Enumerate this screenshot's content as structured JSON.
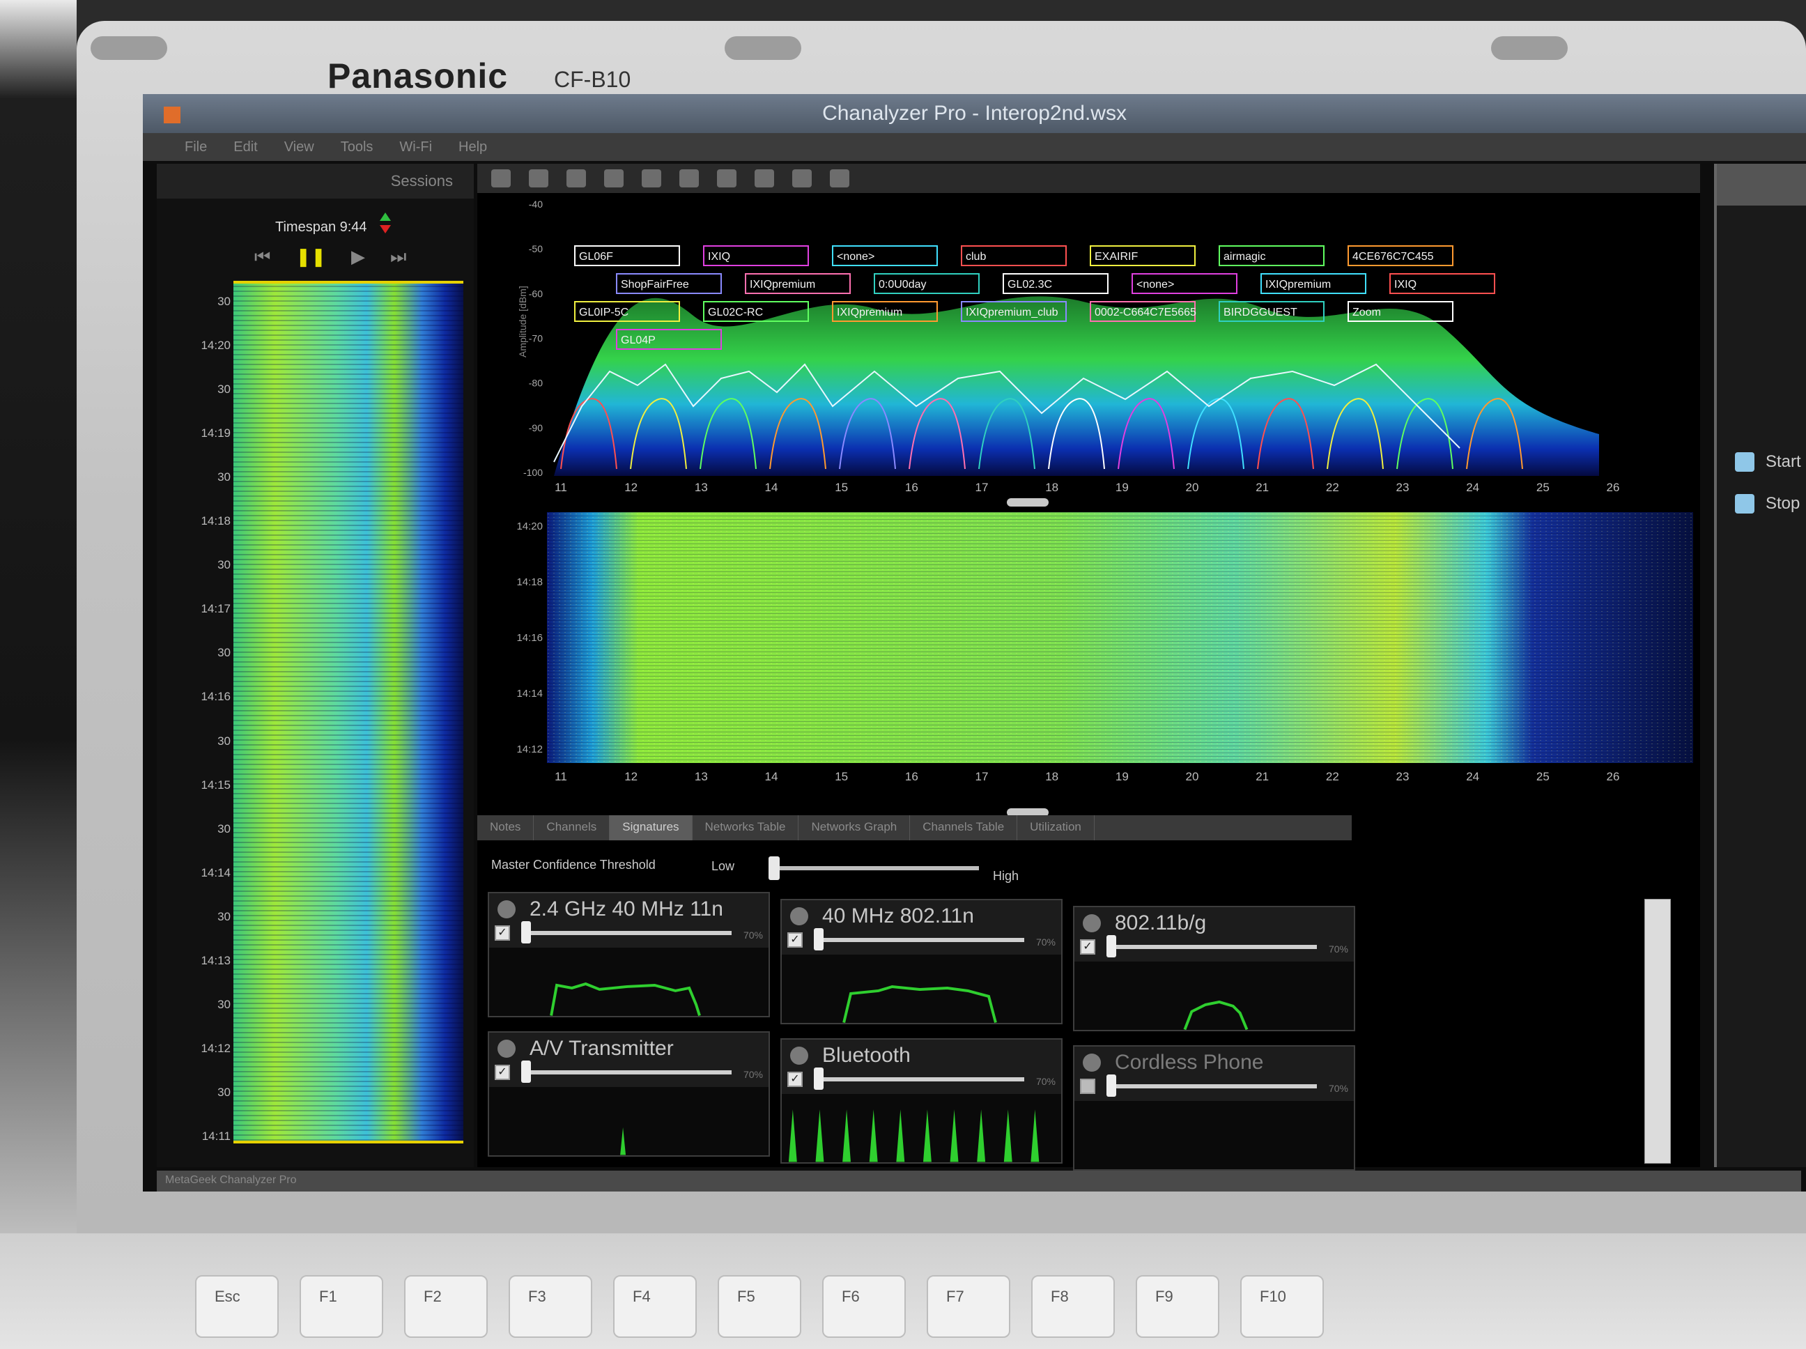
{
  "laptop": {
    "brand": "Panasonic",
    "model": "CF-B10",
    "keys": [
      "Esc",
      "F1",
      "F2",
      "F3",
      "F4",
      "F5",
      "F6",
      "F7",
      "F8",
      "F9",
      "F10"
    ]
  },
  "window": {
    "title": "Chanalyzer Pro - Interop2nd.wsx"
  },
  "menubar": {
    "items": [
      "File",
      "Edit",
      "View",
      "Tools",
      "Wi-Fi",
      "Help"
    ]
  },
  "left_panel": {
    "tab_label": "Sessions",
    "timespan": "Timespan 9:44",
    "time_labels": [
      "30",
      "14:20",
      "30",
      "14:19",
      "30",
      "14:18",
      "30",
      "14:17",
      "30",
      "14:16",
      "30",
      "14:15",
      "30",
      "14:14",
      "30",
      "14:13",
      "30",
      "14:12",
      "30",
      "14:11"
    ]
  },
  "spectrum": {
    "y_ticks": [
      "-40",
      "-50",
      "-60",
      "-70",
      "-80",
      "-90",
      "-100"
    ],
    "y_label": "Amplitude [dBm]",
    "channels": [
      "11",
      "12",
      "13",
      "14",
      "15",
      "16",
      "17",
      "18",
      "19",
      "20",
      "21",
      "22",
      "23",
      "24",
      "25",
      "26"
    ],
    "ssid_labels": [
      "GL06F",
      "IXIQ",
      "<none>",
      "club",
      "EXAIRIF",
      "airmagic",
      "4CE676C7C455",
      "ShopFairFree",
      "IXIQpremium",
      "0:0U0day",
      "GL02.3C",
      "<none>",
      "IXIQpremium",
      "IXIQ",
      "GL0IP-5C",
      "GL02C-RC",
      "IXIQpremium",
      "IXIQpremium_club",
      "0002-C664C7E5665",
      "BIRDGGUEST",
      "Zoom",
      "GL04P"
    ]
  },
  "waterfall": {
    "time_labels": [
      "14:20",
      "14:18",
      "14:16",
      "14:14",
      "14:12"
    ],
    "channels": [
      "11",
      "12",
      "13",
      "14",
      "15",
      "16",
      "17",
      "18",
      "19",
      "20",
      "21",
      "22",
      "23",
      "24",
      "25",
      "26"
    ]
  },
  "tabs": [
    {
      "label": "Notes",
      "active": false
    },
    {
      "label": "Channels",
      "active": false
    },
    {
      "label": "Signatures",
      "active": true
    },
    {
      "label": "Networks Table",
      "active": false
    },
    {
      "label": "Networks Graph",
      "active": false
    },
    {
      "label": "Channels Table",
      "active": false
    },
    {
      "label": "Utilization",
      "active": false
    }
  ],
  "threshold": {
    "label": "Master Confidence Threshold",
    "low": "Low",
    "high": "High",
    "value": 0
  },
  "signatures": [
    {
      "title": "2.4 GHz 40 MHz 11n",
      "checked": true,
      "pct": "70%",
      "level": 0
    },
    {
      "title": "40 MHz 802.11n",
      "checked": true,
      "pct": "70%",
      "level": 0
    },
    {
      "title": "802.11b/g",
      "checked": true,
      "pct": "70%",
      "level": 0
    },
    {
      "title": "A/V Transmitter",
      "checked": true,
      "pct": "70%",
      "level": 0
    },
    {
      "title": "Bluetooth",
      "checked": true,
      "pct": "70%",
      "level": 0
    },
    {
      "title": "Cordless Phone",
      "checked": false,
      "pct": "70%",
      "level": 0
    }
  ],
  "right_panel": {
    "items": [
      "Start",
      "Stop"
    ]
  },
  "statusbar": {
    "text": "MetaGeek Chanalyzer Pro"
  },
  "colors": {
    "waterfall_low": "#07104a",
    "waterfall_mid": "#3dc0d8",
    "waterfall_high": "#9ee83a",
    "signature_trace": "#2fcf2f",
    "pause": "#e6e000"
  }
}
